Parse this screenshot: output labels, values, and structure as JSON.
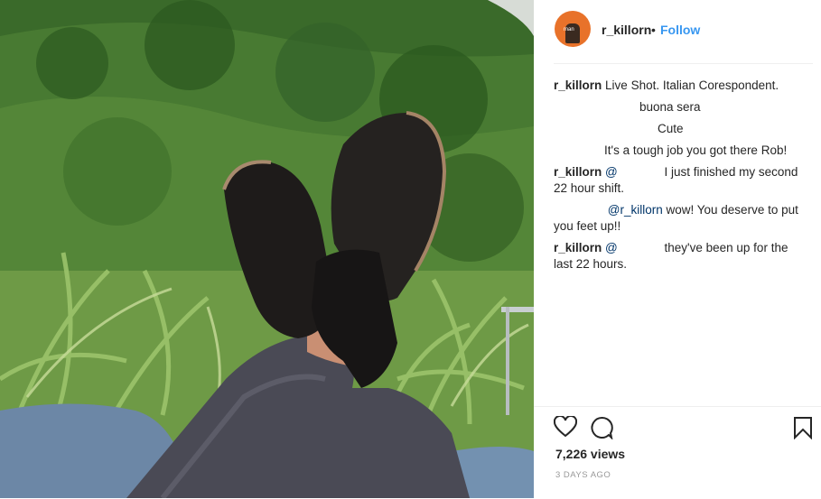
{
  "post": {
    "username": "r_killorn",
    "separator": "•",
    "follow_label": "Follow",
    "avatar_text": "man"
  },
  "comments": [
    {
      "user": "r_killorn",
      "text": "Live Shot. Italian Corespondent."
    },
    {
      "user": "",
      "text": "buona sera"
    },
    {
      "user": "",
      "text": "Cute"
    },
    {
      "user": "",
      "text": "It's a tough job you got there Rob!"
    },
    {
      "user": "r_killorn",
      "mention": "@",
      "text": "I just finished my second",
      "text2": "22 hour shift."
    },
    {
      "user": "",
      "mention": "@r_killorn",
      "text": "wow! You deserve to put",
      "text2": "you feet up!!"
    },
    {
      "user": "r_killorn",
      "mention": "@",
      "text": "they've been up for the",
      "text2": "last 22 hours."
    }
  ],
  "stats": {
    "views": "7,226 views",
    "date": "3 DAYS AGO"
  },
  "icons": {
    "like": "heart-icon",
    "comment": "comment-icon",
    "save": "bookmark-icon"
  }
}
